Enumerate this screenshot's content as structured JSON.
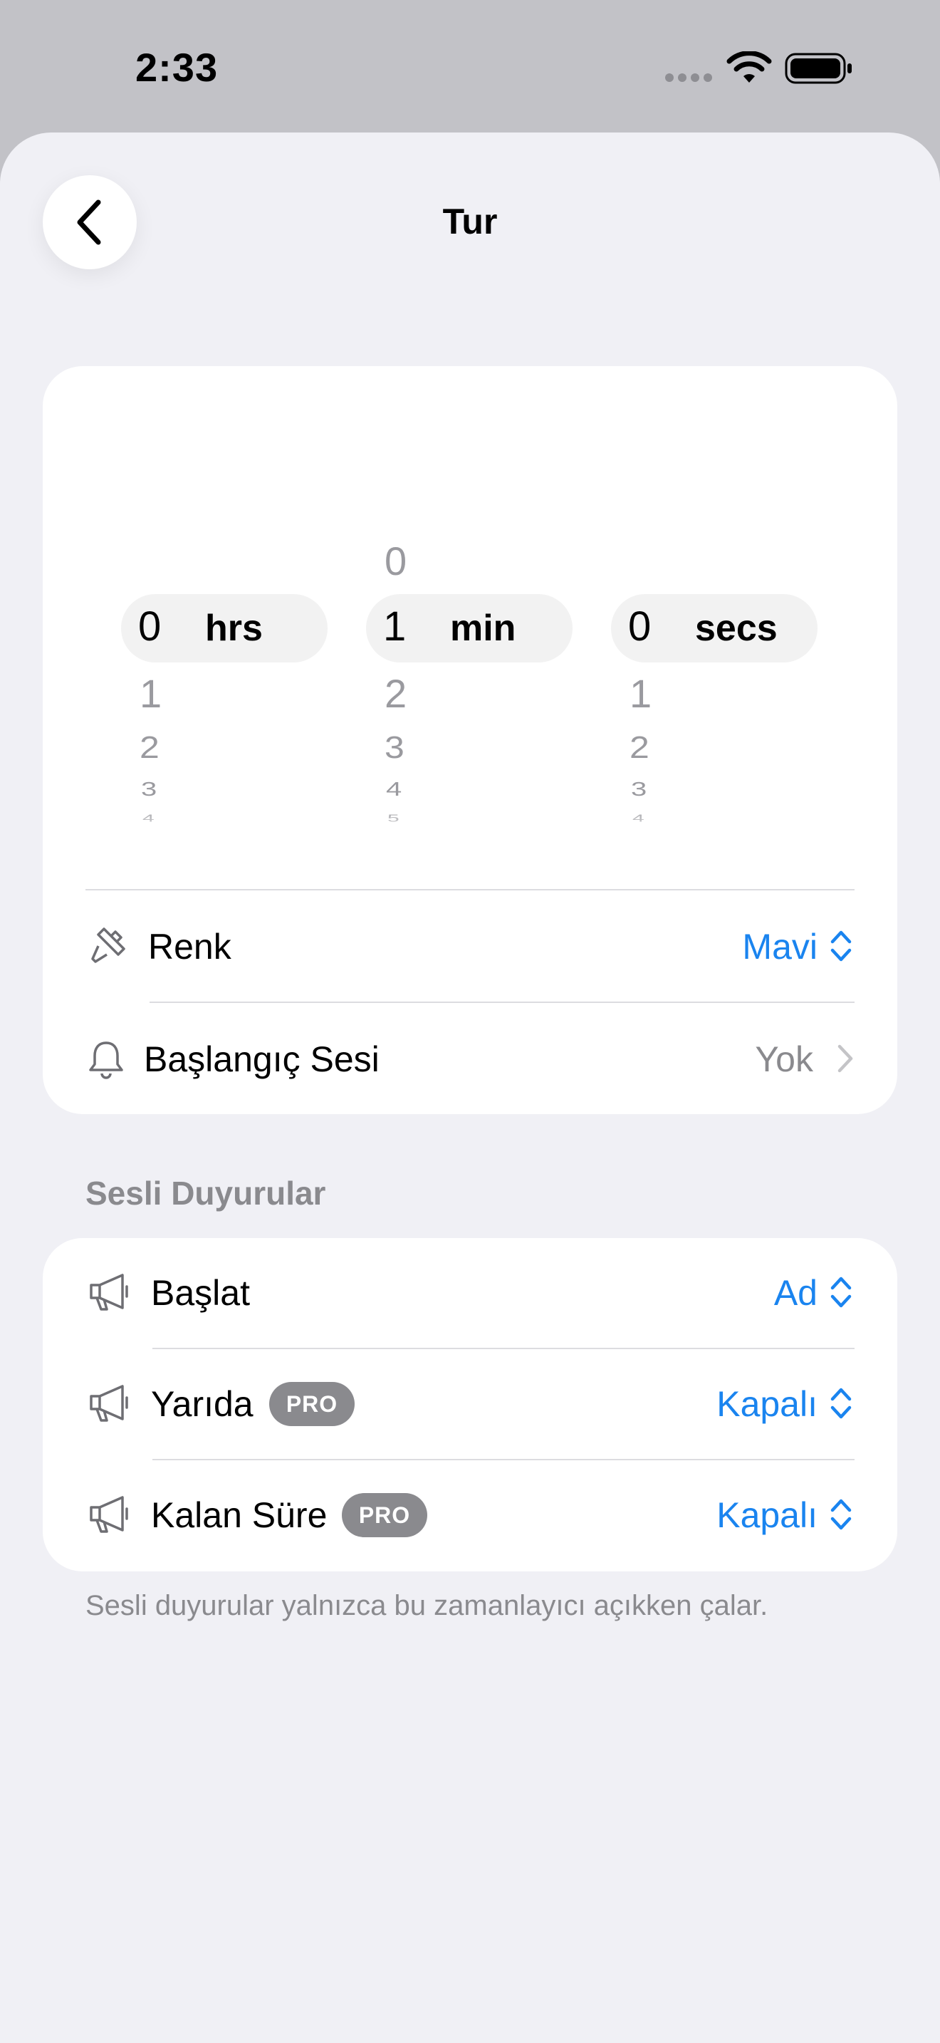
{
  "status": {
    "time": "2:33"
  },
  "nav": {
    "title": "Tur"
  },
  "picker": {
    "hours": {
      "above": "",
      "selected": "0",
      "unit": "hrs",
      "below": [
        "1",
        "2",
        "3",
        "4"
      ]
    },
    "minutes": {
      "above": "0",
      "selected": "1",
      "unit": "min",
      "below": [
        "2",
        "3",
        "4",
        "5"
      ]
    },
    "seconds": {
      "above": "",
      "selected": "0",
      "unit": "secs",
      "below": [
        "1",
        "2",
        "3",
        "4"
      ]
    }
  },
  "settings": {
    "color": {
      "label": "Renk",
      "value": "Mavi",
      "icon": "paintbrush-icon"
    },
    "start_sound": {
      "label": "Başlangıç Sesi",
      "value": "Yok",
      "icon": "bell-icon"
    }
  },
  "announcements": {
    "header": "Sesli Duyurular",
    "rows": [
      {
        "label": "Başlat",
        "value": "Ad",
        "pro": ""
      },
      {
        "label": "Yarıda",
        "value": "Kapalı",
        "pro": "PRO"
      },
      {
        "label": "Kalan Süre",
        "value": "Kapalı",
        "pro": "PRO"
      }
    ],
    "footer": "Sesli duyurular yalnızca bu zamanlayıcı açıkken çalar."
  },
  "colors": {
    "accent": "#1a84ef",
    "background": "#f0f0f5",
    "secondary_text": "#8a8a8e",
    "pro_badge": "#8a8a8e"
  }
}
